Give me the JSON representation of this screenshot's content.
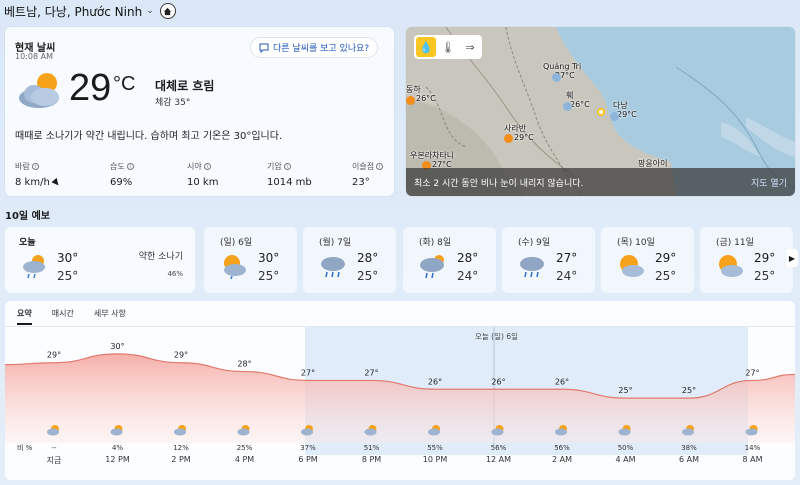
{
  "location": {
    "name": "베트남, 다낭, Phước Ninh"
  },
  "current": {
    "title": "현재 날씨",
    "time": "10:08 AM",
    "ask_button": "다른 날씨를 보고 있나요?",
    "temp": "29",
    "unit": "°C",
    "condition": "대체로 흐림",
    "feels_like": "체감  35°",
    "summary": "때때로 소나기가 약간 내립니다. 습하며 최고 기온은 30°입니다.",
    "metrics": [
      {
        "label": "바람",
        "value": "8 km/h"
      },
      {
        "label": "습도",
        "value": "69%"
      },
      {
        "label": "시야",
        "value": "10 km"
      },
      {
        "label": "기압",
        "value": "1014 mb"
      },
      {
        "label": "이슬점",
        "value": "23°"
      }
    ]
  },
  "map": {
    "cities": [
      {
        "name": "Quảng Trị",
        "temp": "27°C"
      },
      {
        "name": "훼",
        "temp": "26°C"
      },
      {
        "name": "동하",
        "temp": "26°C"
      },
      {
        "name": "다낭",
        "temp": "29°C"
      },
      {
        "name": "사라반",
        "temp": "29°C"
      },
      {
        "name": "우본라차타니",
        "temp": "27°C"
      },
      {
        "name": "팡응아이",
        "temp": ""
      }
    ],
    "footer_text": "최소 2 시간 동안 비나 눈이 내리지 않습니다.",
    "open_link": "지도 열기"
  },
  "forecast": {
    "title": "10일 예보",
    "today": {
      "label": "오늘",
      "hi": "30°",
      "lo": "25°",
      "desc": "약한 소나기",
      "pct": "46%"
    },
    "days": [
      {
        "label": "(일) 6일",
        "hi": "30°",
        "lo": "25°",
        "icon": "partly-cloudy-rain"
      },
      {
        "label": "(월) 7일",
        "hi": "28°",
        "lo": "25°",
        "icon": "rain-cloud"
      },
      {
        "label": "(화) 8일",
        "hi": "28°",
        "lo": "24°",
        "icon": "rain-cloud-sun"
      },
      {
        "label": "(수) 9일",
        "hi": "27°",
        "lo": "24°",
        "icon": "rain-cloud"
      },
      {
        "label": "(목) 10일",
        "hi": "29°",
        "lo": "25°",
        "icon": "partly-cloudy"
      },
      {
        "label": "(금) 11일",
        "hi": "29°",
        "lo": "25°",
        "icon": "partly-cloudy"
      }
    ]
  },
  "hourly": {
    "tabs": [
      "요약",
      "매시간",
      "세부 사항"
    ],
    "precip_label": "비 %",
    "night_label": "오늘  (일) 6일",
    "times": [
      "지금",
      "12 PM",
      "2 PM",
      "4 PM",
      "6 PM",
      "8 PM",
      "10 PM",
      "12 AM",
      "2 AM",
      "4 AM",
      "6 AM",
      "8 AM"
    ]
  },
  "chart_data": {
    "type": "area",
    "x": [
      "지금",
      "12 PM",
      "2 PM",
      "4 PM",
      "6 PM",
      "8 PM",
      "10 PM",
      "12 AM",
      "2 AM",
      "4 AM",
      "6 AM",
      "8 AM"
    ],
    "temps": [
      29,
      30,
      29,
      28,
      27,
      27,
      26,
      26,
      26,
      25,
      25,
      27
    ],
    "precip": [
      "--",
      "4%",
      "12%",
      "25%",
      "37%",
      "51%",
      "55%",
      "56%",
      "56%",
      "50%",
      "38%",
      "14%"
    ]
  },
  "colors": {
    "accent": "#1f57c3",
    "day_fill": "#f6a7a0",
    "night_fill": "#cfe1f5"
  }
}
